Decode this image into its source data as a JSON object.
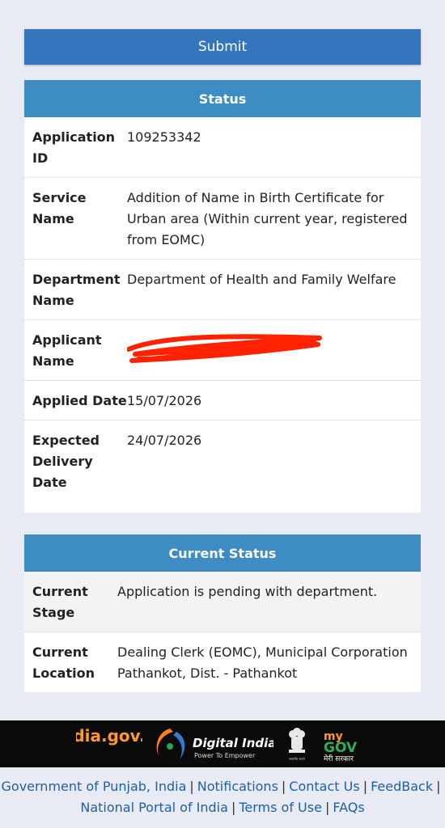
{
  "form": {
    "submit_label": "Submit"
  },
  "status": {
    "heading": "Status",
    "rows": [
      {
        "label": "Application ID",
        "value": "109253342"
      },
      {
        "label": "Service Name",
        "value": "Addition of Name in Birth Certificate for Urban area (Within current year, registered from EOMC)"
      },
      {
        "label": "Department Name",
        "value": "Department of Health and Family Welfare"
      },
      {
        "label": "Applicant Name",
        "value": ""
      },
      {
        "label": "Applied Date",
        "value": "15/07/2026"
      },
      {
        "label": "Expected Delivery Date",
        "value": "24/07/2026"
      }
    ]
  },
  "current_status": {
    "heading": "Current Status",
    "rows": [
      {
        "label": "Current Stage",
        "value": "Application is pending with department."
      },
      {
        "label": "Current Location",
        "value": "Dealing Clerk (EOMC), Municipal Corporation Pathankot, Dist. - Pathankot"
      }
    ]
  },
  "footer": {
    "logos": [
      "india.gov.in",
      "Digital India",
      "Power To Empower",
      "सत्यमेव जयते",
      "my",
      "GOV",
      "मेरी सरकार"
    ],
    "links": [
      "Government of Punjab, India",
      "Notifications",
      "Contact Us",
      "FeedBack",
      "National Portal of India",
      "Terms of Use",
      "FAQs"
    ]
  },
  "colors": {
    "primary": "#3476bd",
    "header": "#3d8cc4",
    "link": "#1f5fa8",
    "redaction": "#ff2200"
  }
}
